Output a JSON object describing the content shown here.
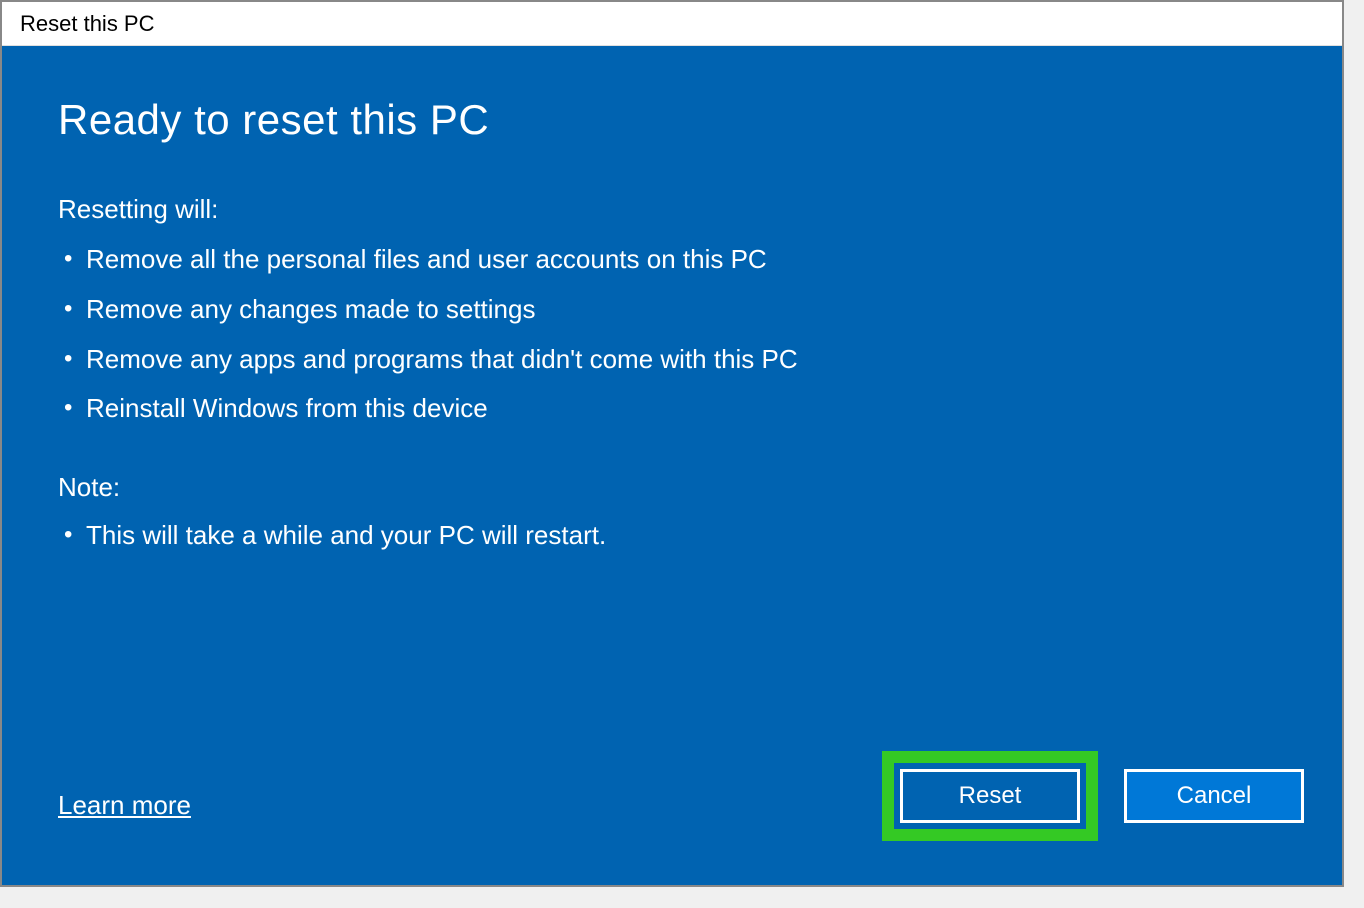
{
  "titlebar": {
    "text": "Reset this PC"
  },
  "main": {
    "heading": "Ready to reset this PC",
    "resetting_label": "Resetting will:",
    "bullets": [
      "Remove all the personal files and user accounts on this PC",
      "Remove any changes made to settings",
      "Remove any apps and programs that didn't come with this PC",
      "Reinstall Windows from this device"
    ],
    "note_label": "Note:",
    "note_bullets": [
      "This will take a while and your PC will restart."
    ],
    "learn_more": "Learn more"
  },
  "buttons": {
    "reset": "Reset",
    "cancel": "Cancel"
  }
}
